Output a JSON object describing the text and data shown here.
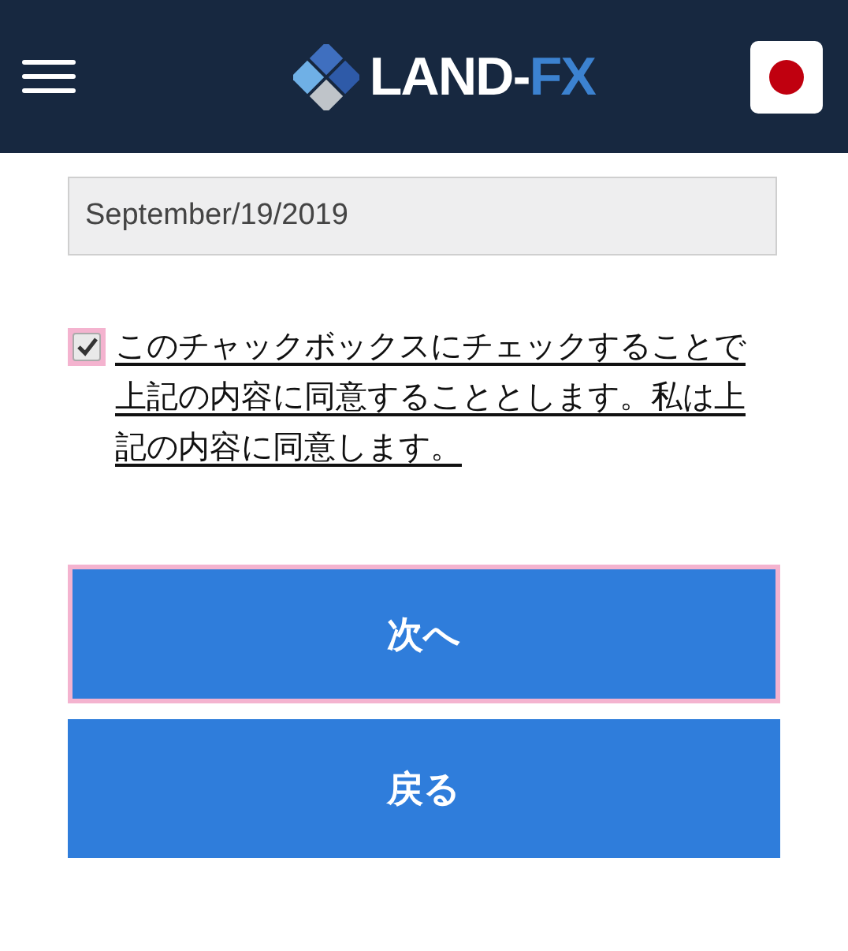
{
  "header": {
    "logo": {
      "text_main": "LAND-",
      "text_accent": "FX"
    }
  },
  "date_field": {
    "value": "September/19/2019"
  },
  "agreement": {
    "checked": true,
    "focused": true,
    "text": "このチャックボックスにチェックすることで上記の内容に同意することとします。私は上記の内容に同意します。"
  },
  "buttons": [
    {
      "label": "次へ",
      "focused": true
    },
    {
      "label": "戻る",
      "focused": false
    }
  ]
}
